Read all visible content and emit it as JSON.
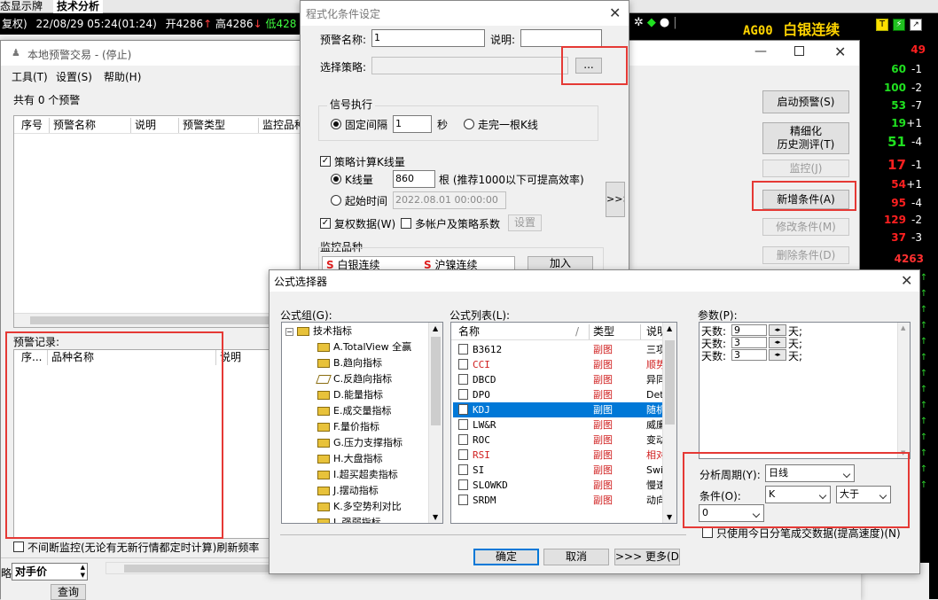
{
  "top_tabs": [
    "态显示牌",
    "技术分析"
  ],
  "ticker": {
    "mode": "复权)",
    "datetime": "22/08/29 05:24(01:24)",
    "open": "开4286",
    "high": "高4286",
    "low": "低428"
  },
  "symbol_title": {
    "code": "AG00",
    "name": "白银连续"
  },
  "quotes": [
    {
      "num": "49",
      "chg": "",
      "num_color": "#ff2020"
    },
    {
      "num": "60",
      "chg": "-1",
      "num_color": "#20e020"
    },
    {
      "num": "100",
      "chg": "-2",
      "num_color": "#20e020"
    },
    {
      "num": "53",
      "chg": "-7",
      "num_color": "#20e020"
    },
    {
      "num": "19",
      "chg": "+1",
      "num_color": "#20e020"
    },
    {
      "num": "51",
      "chg": "-4",
      "num_color": "#20e020"
    },
    {
      "num": "17",
      "chg": "-1",
      "num_color": "#ff2020"
    },
    {
      "num": "54",
      "chg": "+1",
      "num_color": "#ff2020"
    },
    {
      "num": "95",
      "chg": "-4",
      "num_color": "#ff2020"
    },
    {
      "num": "129",
      "chg": "-2",
      "num_color": "#ff2020"
    },
    {
      "num": "37",
      "chg": "-3",
      "num_color": "#ff2020"
    }
  ],
  "quote_footer": "4263",
  "local_alert": {
    "title": "本地预警交易 - (停止)",
    "menu": [
      "工具(T)",
      "设置(S)",
      "帮助(H)"
    ],
    "count_text": "共有 0 个预警",
    "alert_columns": [
      "序号",
      "预警名称",
      "说明",
      "预警类型",
      "监控品种"
    ],
    "record_label": "预警记录:",
    "record_columns": [
      "序...",
      "品种名称",
      "说明"
    ],
    "continuous_label": "不间断监控(无论有无新行情都定时计算)刷新频率",
    "price_label": "对手价",
    "price_prefix": "略",
    "query_label": "查询",
    "buttons": {
      "start": "启动预警(S)",
      "refine": [
        "精细化",
        "历史测评(T)"
      ],
      "monitor": "监控(J)",
      "add_condition": "新增条件(A)",
      "edit_condition": "修改条件(M)",
      "delete_condition": "删除条件(D)"
    }
  },
  "cond_dialog": {
    "title": "程式化条件设定",
    "name_label": "预警名称:",
    "name_value": "1",
    "desc_label": "说明:",
    "desc_value": "",
    "strategy_label": "选择策略:",
    "strategy_value": "",
    "browse_label": "...",
    "signal_group": "信号执行",
    "fixed_interval_label": "固定间隔",
    "interval_value": "1",
    "seconds_label": "秒",
    "finish_kline_label": "走完一根K线",
    "calc_kline_label": "策略计算K线量",
    "kline_qty_label": "K线量",
    "kline_qty_value": "860",
    "kline_hint": "根 (推荐1000以下可提高效率)",
    "start_time_label": "起始时间",
    "start_time_value": "2022.08.01 00:00:00",
    "adjusted_label": "复权数据(W)",
    "multi_account_label": "多帐户及策略系数",
    "settings_label": "设置",
    "monitor_label": "监控品种",
    "monitor_items": [
      "白银连续",
      "沪镍连续"
    ],
    "add_label": "加入",
    "expand_label": ">>>"
  },
  "formula_dialog": {
    "title": "公式选择器",
    "group_label": "公式组(G):",
    "list_label": "公式列表(L):",
    "param_label": "参数(P):",
    "tree_root": "技术指标",
    "tree_items": [
      "A.TotalView 全赢",
      "B.趋向指标",
      "C.反趋向指标",
      "D.能量指标",
      "E.成交量指标",
      "F.量价指标",
      "G.压力支撑指标",
      "H.大盘指标",
      "I.超买超卖指标",
      "J.摆动指标",
      "K.多空势利对比",
      "L.强弱指标"
    ],
    "list_columns": [
      "名称",
      "类型",
      "说明"
    ],
    "list_rows": [
      {
        "name": "B3612",
        "type": "副图",
        "desc": "三项",
        "red": false,
        "selected": false
      },
      {
        "name": "CCI",
        "type": "副图",
        "desc": "顺势",
        "red": true,
        "selected": false
      },
      {
        "name": "DBCD",
        "type": "副图",
        "desc": "异同",
        "red": false,
        "selected": false
      },
      {
        "name": "DPO",
        "type": "副图",
        "desc": "Det",
        "red": false,
        "selected": false
      },
      {
        "name": "KDJ",
        "type": "副图",
        "desc": "随机",
        "red": false,
        "selected": true
      },
      {
        "name": "LW&R",
        "type": "副图",
        "desc": "威廉",
        "red": false,
        "selected": false
      },
      {
        "name": "ROC",
        "type": "副图",
        "desc": "变动",
        "red": false,
        "selected": false
      },
      {
        "name": "RSI",
        "type": "副图",
        "desc": "相对",
        "red": true,
        "selected": false
      },
      {
        "name": "SI",
        "type": "副图",
        "desc": "Swi",
        "red": false,
        "selected": false
      },
      {
        "name": "SLOWKD",
        "type": "副图",
        "desc": "慢速",
        "red": false,
        "selected": false
      },
      {
        "name": "SRDM",
        "type": "副图",
        "desc": "动向",
        "red": false,
        "selected": false
      }
    ],
    "params": [
      {
        "label": "天数:",
        "value": "9",
        "unit": "天;"
      },
      {
        "label": "天数:",
        "value": "3",
        "unit": "天;"
      },
      {
        "label": "天数:",
        "value": "3",
        "unit": "天;"
      }
    ],
    "period_label": "分析周期(Y):",
    "period_value": "日线",
    "condition_label": "条件(O):",
    "condition_value": "K",
    "compare_value": "大于",
    "threshold_value": "0",
    "today_only_label": "只使用今日分笔成交数据(提高速度)(N)",
    "ok": "确定",
    "cancel": "取消",
    "more": ">>> 更多(D)"
  }
}
